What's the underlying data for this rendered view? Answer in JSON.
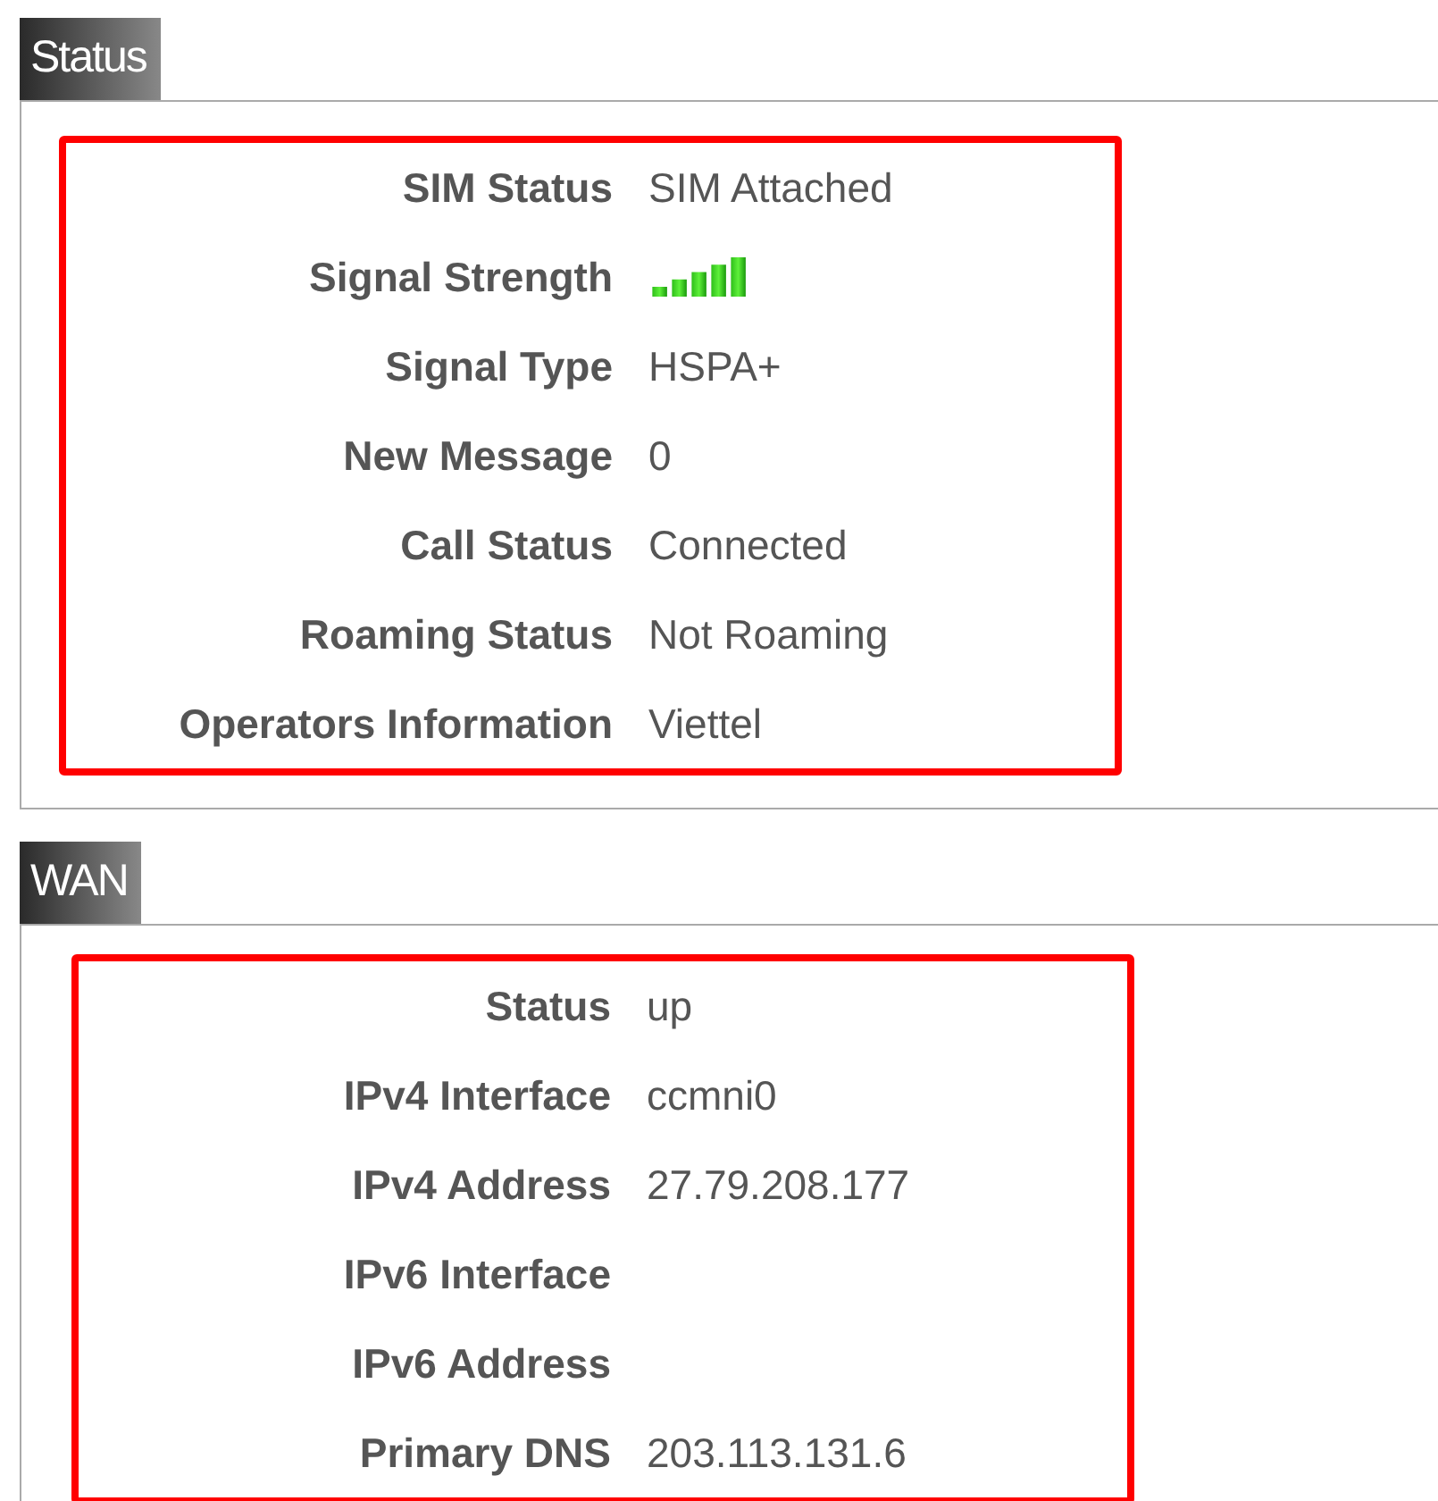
{
  "sections": [
    {
      "title": "Status",
      "rows": [
        {
          "kind": "text",
          "label": "SIM Status",
          "value": "SIM Attached"
        },
        {
          "kind": "signal",
          "label": "Signal Strength"
        },
        {
          "kind": "text",
          "label": "Signal Type",
          "value": "HSPA+"
        },
        {
          "kind": "text",
          "label": "New Message",
          "value": "0"
        },
        {
          "kind": "text",
          "label": "Call Status",
          "value": "Connected"
        },
        {
          "kind": "text",
          "label": "Roaming Status",
          "value": "Not Roaming"
        },
        {
          "kind": "text",
          "label": "Operators Information",
          "value": "Viettel"
        }
      ]
    },
    {
      "title": "WAN",
      "rows": [
        {
          "kind": "text",
          "label": "Status",
          "value": "up"
        },
        {
          "kind": "text",
          "label": "IPv4 Interface",
          "value": "ccmni0"
        },
        {
          "kind": "text",
          "label": "IPv4 Address",
          "value": "27.79.208.177"
        },
        {
          "kind": "text",
          "label": "IPv6 Interface"
        },
        {
          "kind": "text",
          "label": "IPv6 Address"
        },
        {
          "kind": "text",
          "label": "Primary DNS",
          "value": "203.113.131.6"
        }
      ]
    }
  ]
}
